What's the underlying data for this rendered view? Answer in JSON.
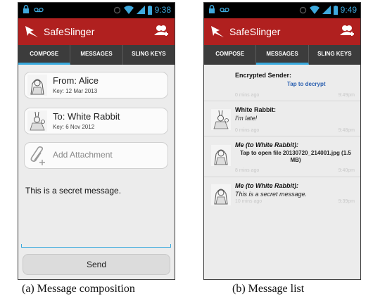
{
  "screen_a": {
    "status_time": "9:38",
    "app_title": "SafeSlinger",
    "tabs": [
      {
        "label": "COMPOSE",
        "active": true
      },
      {
        "label": "MESSAGES",
        "active": false
      },
      {
        "label": "SLING KEYS",
        "active": false
      }
    ],
    "from": {
      "label": "From: Alice",
      "key": "Key: 12 Mar 2013"
    },
    "to": {
      "label": "To: White Rabbit",
      "key": "Key: 6 Nov 2012"
    },
    "attachment": {
      "label": "Add Attachment"
    },
    "message_body": "This is a secret message.",
    "send_label": "Send",
    "caption": "(a) Message composition"
  },
  "screen_b": {
    "status_time": "9:49",
    "app_title": "SafeSlinger",
    "tabs": [
      {
        "label": "COMPOSE",
        "active": false
      },
      {
        "label": "MESSAGES",
        "active": true
      },
      {
        "label": "SLING KEYS",
        "active": false
      }
    ],
    "messages": [
      {
        "sender": "Encrypted Sender:",
        "text": "Tap to decrypt",
        "age": "0 mins ago",
        "time": "9:49pm"
      },
      {
        "sender": "White Rabbit:",
        "text": "I'm late!",
        "age": "0 mins ago",
        "time": "9:48pm"
      },
      {
        "sender": "Me (to White Rabbit):",
        "text": "Tap to open file 20130720_214001.jpg (1.5 MB)",
        "age": "8 mins ago",
        "time": "9:40pm"
      },
      {
        "sender": "Me (to White Rabbit):",
        "text": "This is a secret message.",
        "age": "10 mins ago",
        "time": "9:39pm"
      }
    ],
    "caption": "(b) Message list"
  },
  "colors": {
    "appbar": "#b0201f",
    "accent": "#38a9dd",
    "tabbar": "#3c3c3c",
    "status_icons": "#3ea9dd"
  },
  "icons": {
    "status_left": [
      "lock-icon",
      "voicemail-icon"
    ],
    "status_right": [
      "sync-icon",
      "wifi-icon",
      "signal-icon",
      "battery-icon"
    ],
    "appbar": [
      "safeslinger-logo-icon",
      "add-contact-icon"
    ],
    "attachment": "paperclip-add-icon",
    "avatars": [
      "alice-avatar",
      "white-rabbit-avatar"
    ]
  }
}
